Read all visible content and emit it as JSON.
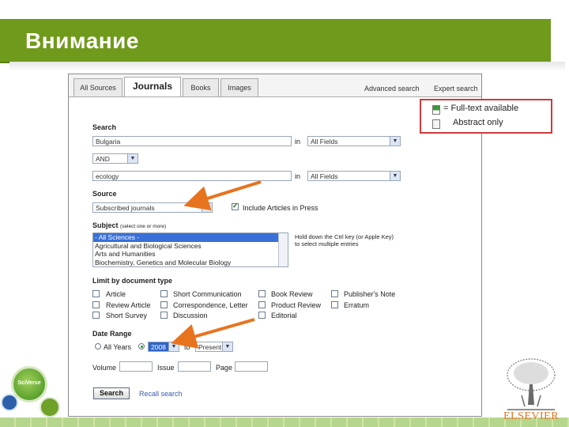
{
  "slide": {
    "title": "Внимание"
  },
  "tabs": [
    "All Sources",
    "Journals",
    "Books",
    "Images"
  ],
  "top_links": {
    "advanced": "Advanced search",
    "expert": "Expert search"
  },
  "search": {
    "label": "Search",
    "term1": "Bulgaria",
    "in1": "in",
    "field1": "All Fields",
    "operator": "AND",
    "term2": "ecology",
    "in2": "in",
    "field2": "All Fields"
  },
  "source": {
    "label": "Source",
    "value": "Subscribed journals",
    "include_in_press": "Include Articles in Press"
  },
  "subject": {
    "label": "Subject",
    "sublabel": "(select one or more)",
    "hint_line1": "Hold down the Ctrl key (or Apple Key)",
    "hint_line2": "to select multiple entries",
    "items": [
      "- All Sciences -",
      "Agricultural and Biological Sciences",
      "Arts and Humanities",
      "Biochemistry, Genetics and Molecular Biology"
    ]
  },
  "doc_type": {
    "label": "Limit by document type",
    "col1": [
      "Article",
      "Review Article",
      "Short Survey"
    ],
    "col2": [
      "Short Communication",
      "Correspondence, Letter",
      "Discussion"
    ],
    "col3": [
      "Book Review",
      "Product Review",
      "Editorial"
    ],
    "col4": [
      "Publisher's Note",
      "Erratum"
    ]
  },
  "date_range": {
    "label": "Date Range",
    "all_years": "All Years",
    "from": "2008",
    "to": "to",
    "to_value": "Present"
  },
  "citation": {
    "volume": "Volume",
    "issue": "Issue",
    "page": "Page"
  },
  "actions": {
    "search": "Search",
    "recall": "Recall search"
  },
  "legend": {
    "full_text": "= Full-text available",
    "abstract": "Abstract only"
  },
  "logos": {
    "sciverse": "SciVerse",
    "elsevier": "ELSEVIER"
  },
  "colors": {
    "banner": "#6f9a1c",
    "arrow": "#e8731e",
    "legend_border": "#d23a3a",
    "elsevier": "#e9711c"
  }
}
